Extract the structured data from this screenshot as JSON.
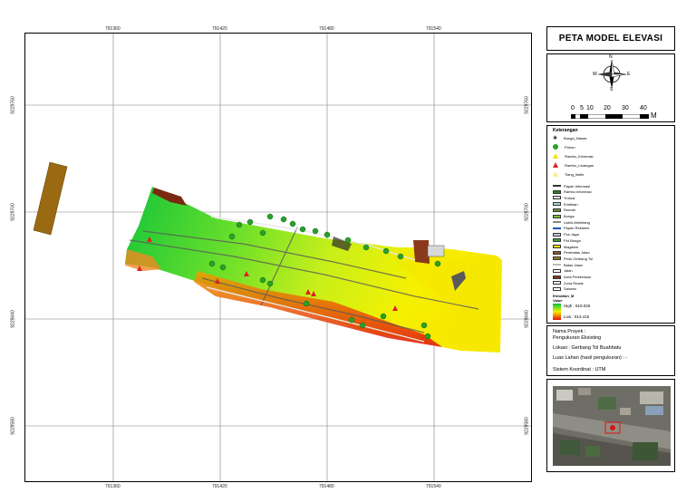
{
  "map": {
    "x_ticks": [
      "791360",
      "791420",
      "791480",
      "791540"
    ],
    "y_ticks": [
      "9229760",
      "9229700",
      "9229640",
      "9229580"
    ]
  },
  "title": "PETA MODEL ELEVASI",
  "north_arrow": {
    "n": "N",
    "s": "S",
    "e": "E",
    "w": "W"
  },
  "scale_bar": {
    "labels": [
      "0",
      "5",
      "10",
      "20",
      "30",
      "40"
    ],
    "unit": "M"
  },
  "legend": {
    "header": "Keterangan",
    "points": [
      {
        "label": "Bunga_Nanas",
        "icon": "cross-plant-icon",
        "color": "#444444"
      },
      {
        "label": "Pohon",
        "icon": "tree-icon",
        "color": "#2aa02a"
      },
      {
        "label": "Rambu_Informasi",
        "icon": "triangle-icon",
        "color": "#f2e600"
      },
      {
        "label": "Rambu_Larangan",
        "icon": "triangle-icon",
        "color": "#e02020"
      },
      {
        "label": "Tiang_listrik",
        "icon": "triangle-icon",
        "color": "#f7f08a"
      }
    ],
    "areas": [
      {
        "label": "Papan Informasi",
        "color": "#333333",
        "kind": "line"
      },
      {
        "label": "Rambu Informasi",
        "color": "#2f7a2f",
        "kind": "fill"
      },
      {
        "label": "Trotoar",
        "color": "#dddddd",
        "kind": "fill"
      },
      {
        "label": "Embikan",
        "color": "#9fd9d9",
        "kind": "fill"
      },
      {
        "label": "Rumah",
        "color": "#6a8f3a",
        "kind": "fill"
      },
      {
        "label": "Bunga",
        "color": "#7fbf3f",
        "kind": "fill"
      },
      {
        "label": "Listrik Melintang",
        "color": "#888888",
        "kind": "line"
      },
      {
        "label": "Papan Reklame",
        "color": "#1f4fbf",
        "kind": "line"
      },
      {
        "label": "Pos Jaga",
        "color": "#b9c9de",
        "kind": "fill"
      },
      {
        "label": "Pot Bunga",
        "color": "#3aa03a",
        "kind": "fill"
      },
      {
        "label": "Magalow",
        "color": "#f0f000",
        "kind": "fill"
      },
      {
        "label": "Pembatas Jalan",
        "color": "#8a5a2a",
        "kind": "fill"
      },
      {
        "label": "Pintu Gerbang Tol",
        "color": "#a07a2a",
        "kind": "fill"
      },
      {
        "label": "Batas Jalan",
        "color": "#bbbbbb",
        "kind": "line"
      },
      {
        "label": "Jalan",
        "color": "#ffffff",
        "kind": "fill"
      },
      {
        "label": "Area Perkerasan",
        "color": "#7a3a1a",
        "kind": "fill"
      },
      {
        "label": "Zona Rusak",
        "color": "#e8f0e8",
        "kind": "fill"
      },
      {
        "label": "Saluran",
        "color": "#ffffff",
        "kind": "fill"
      }
    ],
    "elev_header": "Elevation_M",
    "value_header": "Value",
    "high": "High : 819.026",
    "low": "Low : 813.415"
  },
  "info": {
    "nama_proyek": "Nama Proyek :",
    "nama_proyek_value": "Pengukuran Eksisting",
    "lokasi": "Lokasi : Gerbang Tol Buahbatu",
    "luas": "Luas Lahan (hasil pengukuran) : -",
    "sistem": "Sistem Koordinat : UTM"
  },
  "colors": {
    "high": "#00c040",
    "mid": "#f0f000",
    "low": "#e01010"
  }
}
